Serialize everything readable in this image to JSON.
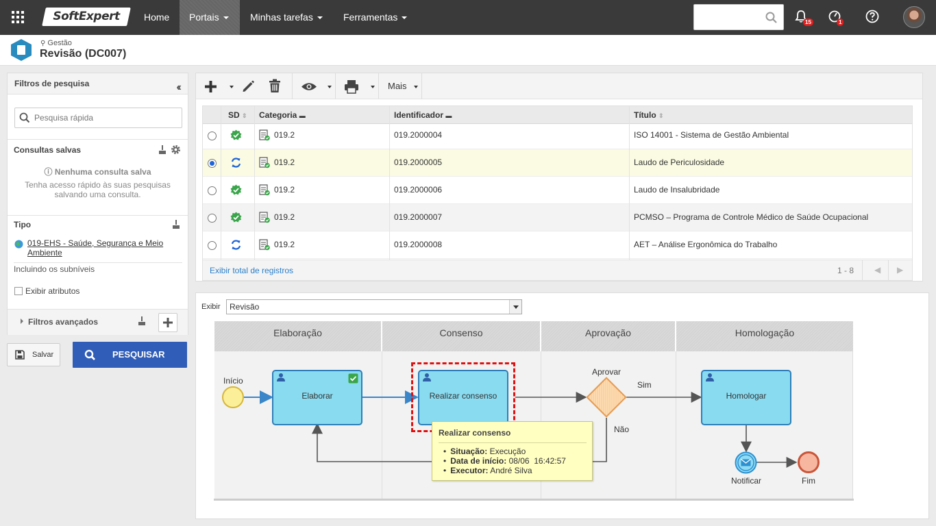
{
  "topnav": {
    "logo": "SoftExpert",
    "items": [
      {
        "label": "Home"
      },
      {
        "label": "Portais"
      },
      {
        "label": "Minhas tarefas"
      },
      {
        "label": "Ferramentas"
      }
    ],
    "notifications_count": "15",
    "tasks_count": "1"
  },
  "header": {
    "breadcrumb": "Gestão",
    "title": "Revisão (DC007)"
  },
  "filters": {
    "title": "Filtros de pesquisa",
    "search_placeholder": "Pesquisa rápida",
    "saved_title": "Consultas salvas",
    "saved_empty": "Nenhuma consulta salva",
    "saved_hint_1": "Tenha acesso rápido às suas pesquisas",
    "saved_hint_2": "salvando uma consulta.",
    "tipo_title": "Tipo",
    "tipo_link_1": "019-EHS - Saúde, Segurança e Meio",
    "tipo_link_2": "Ambiente",
    "include_sub": "Incluindo os subníveis",
    "show_attrs": "Exibir atributos",
    "advanced": "Filtros avançados",
    "save_label": "Salvar",
    "search_label": "PESQUISAR"
  },
  "toolbar": {
    "more_label": "Mais"
  },
  "grid": {
    "columns": [
      "SD",
      "Categoria",
      "Identificador",
      "Título"
    ],
    "rows": [
      {
        "status": "done",
        "categoria": "019.2",
        "identificador": "019.2000004",
        "titulo": "ISO 14001 - Sistema de Gestão Ambiental"
      },
      {
        "status": "sync",
        "categoria": "019.2",
        "identificador": "019.2000005",
        "titulo": "Laudo de Periculosidade"
      },
      {
        "status": "done",
        "categoria": "019.2",
        "identificador": "019.2000006",
        "titulo": "Laudo de Insalubridade"
      },
      {
        "status": "done",
        "categoria": "019.2",
        "identificador": "019.2000007",
        "titulo": "PCMSO – Programa de Controle Médico de Saúde Ocupacional"
      },
      {
        "status": "sync",
        "categoria": "019.2",
        "identificador": "019.2000008",
        "titulo": "AET – Análise Ergonômica do Trabalho"
      }
    ],
    "footer_link": "Exibir total de registros",
    "pager": "1 - 8"
  },
  "process": {
    "exibir_label": "Exibir",
    "exibir_value": "Revisão",
    "lanes": [
      "Elaboração",
      "Consenso",
      "Aprovação",
      "Homologação"
    ],
    "start_label": "Início",
    "task_elaborar": "Elaborar",
    "task_consenso": "Realizar consenso",
    "gateway_label": "Aprovar",
    "yes_label": "Sim",
    "no_label": "Não",
    "task_homologar": "Homologar",
    "notify_label": "Notificar",
    "end_label": "Fim",
    "tooltip": {
      "title": "Realizar consenso",
      "situacao_label": "Situação:",
      "situacao_value": "Execução",
      "inicio_label": "Data de início:",
      "inicio_value": "08/06  16:42:57",
      "executor_label": "Executor:",
      "executor_value": "André Silva"
    }
  },
  "colors": {
    "topbar": "#3a3a3a",
    "primary_button": "#2f5db8",
    "task_fill": "#89dbf0",
    "task_border": "#2e7db8",
    "selected_row": "#fbfbe3",
    "highlight_dashed": "#e01010",
    "status_green": "#3aa54a",
    "status_blue": "#1e64d8"
  }
}
